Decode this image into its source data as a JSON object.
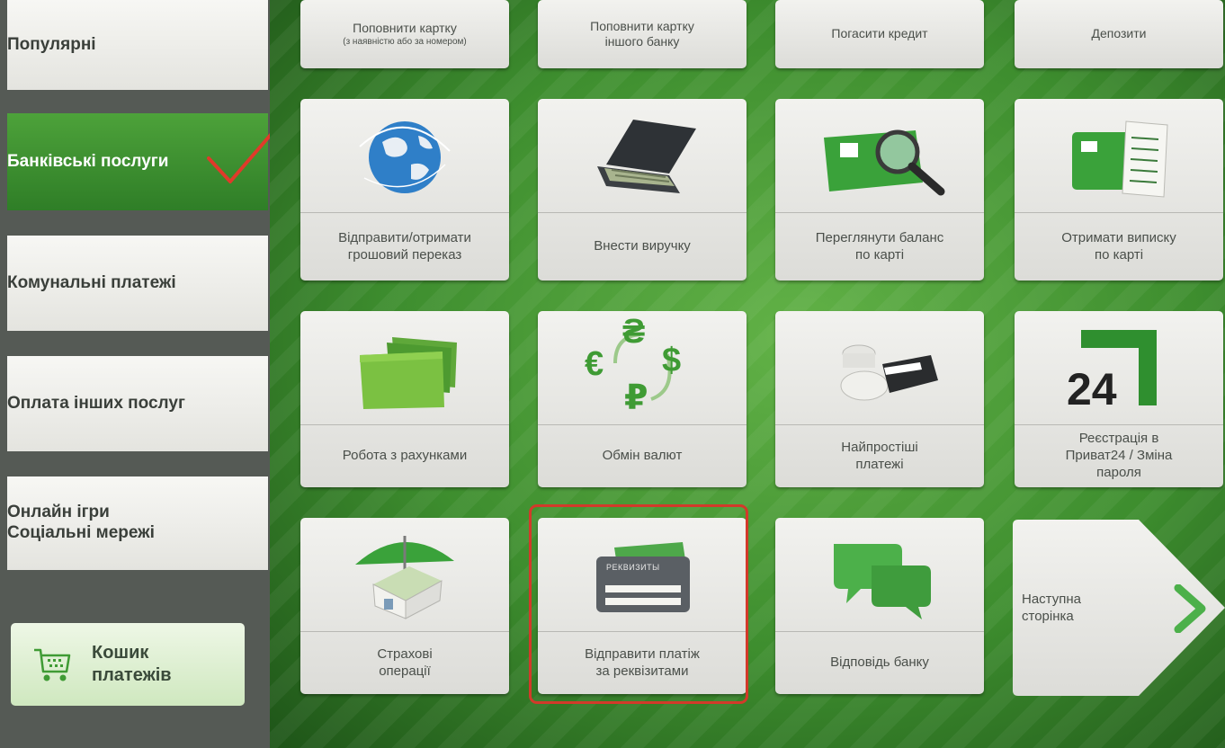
{
  "sidebar": {
    "items": [
      {
        "label": "Популярні"
      },
      {
        "label": "Банківські послуги"
      },
      {
        "label": "Комунальні платежі"
      },
      {
        "label": "Оплата інших послуг"
      },
      {
        "label": "Онлайн ігри\nСоціальні мережі"
      }
    ],
    "active_index": 1,
    "cart_label": "Кошик\nплатежів"
  },
  "top_row": [
    {
      "label": "Поповнити картку",
      "sub": "(з наявністю або за номером)"
    },
    {
      "label": "Поповнити картку\nіншого банку"
    },
    {
      "label": "Погасити кредит"
    },
    {
      "label": "Депозити"
    }
  ],
  "tiles": [
    {
      "label": "Відправити/отримати\nгрошовий переказ",
      "icon": "globe-icon"
    },
    {
      "label": "Внести виручку",
      "icon": "cash-case-icon"
    },
    {
      "label": "Переглянути баланс\nпо карті",
      "icon": "card-magnifier-icon"
    },
    {
      "label": "Отримати виписку\nпо карті",
      "icon": "card-statement-icon"
    },
    {
      "label": "Робота з рахунками",
      "icon": "folder-icon"
    },
    {
      "label": "Обмін валют",
      "icon": "currency-exchange-icon"
    },
    {
      "label": "Найпростіші\nплатежі",
      "icon": "coins-wallet-icon"
    },
    {
      "label": "Реєстрація в\nПриват24 / Зміна\nпароля",
      "icon": "privat24-logo-icon"
    },
    {
      "label": "Страхові\nоперації",
      "icon": "house-umbrella-icon"
    },
    {
      "label": "Відправити платіж\nза реквізитами",
      "icon": "wallet-requisites-icon"
    },
    {
      "label": "Відповідь банку",
      "icon": "chat-bubbles-icon"
    }
  ],
  "icon_text": {
    "currency_symbols": [
      "₴",
      "€",
      "$",
      "₽"
    ],
    "privat24": "24",
    "wallet_tag": "РЕКВИЗИТЫ"
  },
  "next_page_label": "Наступна\nсторінка",
  "colors": {
    "accent_green": "#3d8d2e",
    "active_sidebar": "#2f7e27",
    "highlight_red": "#d23a2a",
    "checkmark_red": "#e03a2a"
  }
}
